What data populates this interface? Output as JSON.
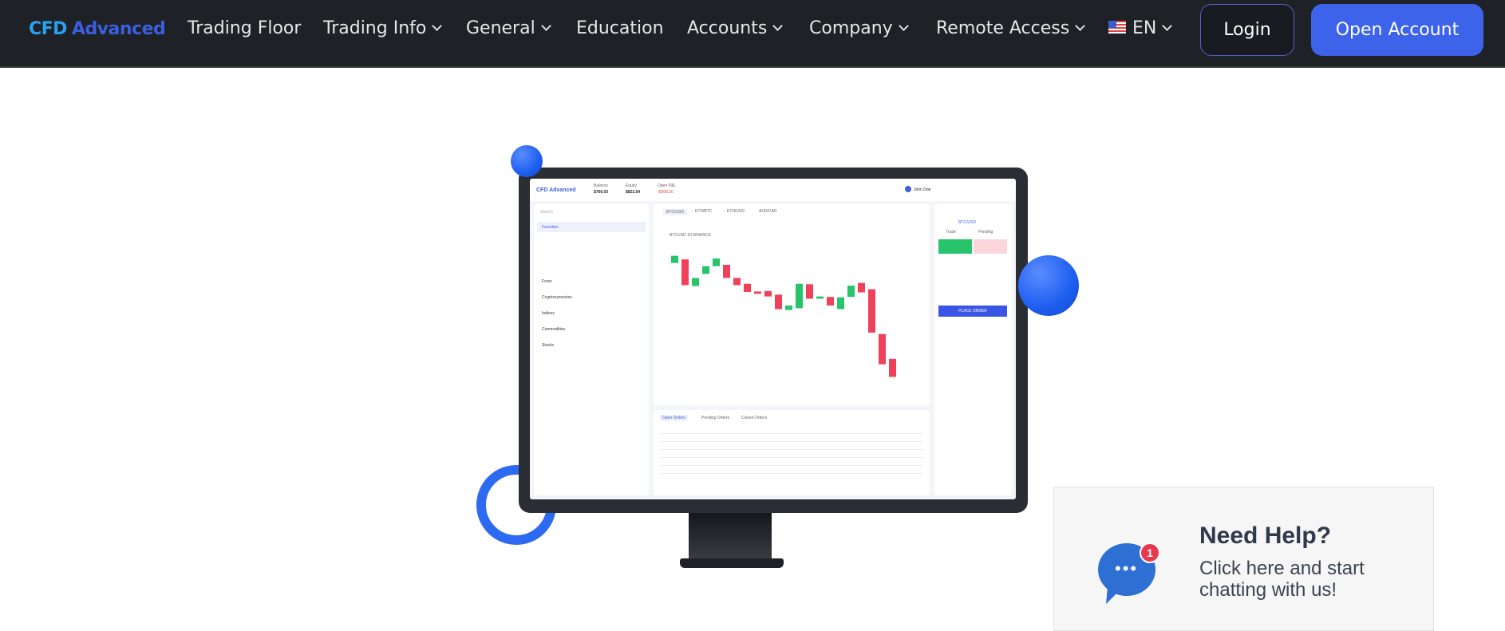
{
  "nav": {
    "logo_mark": "CFD",
    "logo_text": "Advanced",
    "items": [
      {
        "label": "Trading Floor",
        "dropdown": false
      },
      {
        "label": "Trading Info",
        "dropdown": true
      },
      {
        "label": "General",
        "dropdown": true
      },
      {
        "label": "Education",
        "dropdown": false
      },
      {
        "label": "Accounts",
        "dropdown": true
      },
      {
        "label": "Company",
        "dropdown": true
      },
      {
        "label": "Remote Access",
        "dropdown": true
      }
    ],
    "language": "EN",
    "login_label": "Login",
    "open_account_label": "Open Account"
  },
  "mockup": {
    "app_logo": "CFD Advanced",
    "balance_label": "Balance",
    "balance": "$766.03",
    "equity_label": "Equity",
    "equity": "$822.54",
    "pnl_label": "Open P&L",
    "pnl": "-$308.20",
    "user": "John Doe",
    "search_placeholder": "Search",
    "categories": [
      "Favorites",
      "Forex",
      "Cryptocurrencies",
      "Indices",
      "Commodities",
      "Stocks"
    ],
    "symbols": [
      "BTC/USD",
      "ETH/BTC",
      "ETH/USD",
      "AUD/CAD"
    ],
    "chart_title": "BTCUSD 1D BINANCE",
    "trade_tabs": [
      "Trade",
      "Pending"
    ],
    "place_order": "PLACE ORDER",
    "order_tabs": [
      "Open Orders",
      "Pending Orders",
      "Closed Orders"
    ],
    "candles": [
      [
        267,
        283
      ],
      [
        275,
        218
      ],
      [
        216,
        234
      ],
      [
        243,
        260
      ],
      [
        260,
        277
      ],
      [
        263,
        234
      ],
      [
        234,
        218
      ],
      [
        221,
        203
      ],
      [
        204,
        199
      ],
      [
        205,
        193
      ],
      [
        197,
        165
      ],
      [
        163,
        173
      ],
      [
        167,
        221
      ],
      [
        220,
        188
      ],
      [
        188,
        193
      ],
      [
        192,
        173
      ],
      [
        165,
        191
      ],
      [
        192,
        217
      ],
      [
        223,
        202
      ],
      [
        209,
        113
      ],
      [
        110,
        43
      ],
      [
        55,
        15
      ]
    ],
    "up_color": "#27c46b",
    "down_color": "#f0415a"
  },
  "help": {
    "title": "Need Help?",
    "text": "Click here and start chatting with us!",
    "badge_count": "1"
  },
  "colors": {
    "nav_bg": "#1e2227",
    "accent": "#3c63ea"
  }
}
